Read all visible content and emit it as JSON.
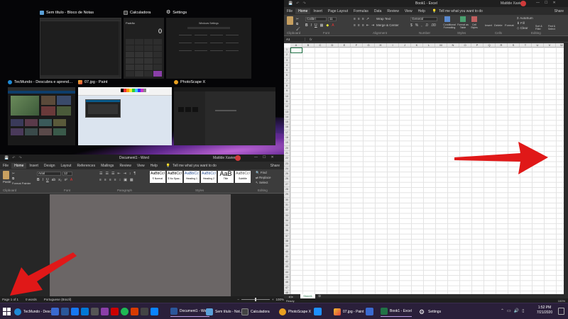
{
  "snap": {
    "thumbnails": [
      {
        "title": "Sem título - Bloco de Notas",
        "icon": "notepad-icon"
      },
      {
        "title": "Calculadora",
        "icon": "calculator-icon"
      },
      {
        "title": "Settings",
        "icon": "gear-icon"
      },
      {
        "title": "TecMundo - Descubra e aprenda tudo sobre...",
        "icon": "edge-icon"
      },
      {
        "title": "07.jpg - Paint",
        "icon": "paint-icon"
      },
      {
        "title": "PhotoScape X",
        "icon": "photoscape-icon"
      }
    ],
    "calc_display": "0",
    "calc_mode": "Padrão",
    "settings_heading": "Windows Settings"
  },
  "word": {
    "title": "Document1 - Word",
    "user": "Matilde Xavier",
    "tabs": [
      "File",
      "Home",
      "Insert",
      "Design",
      "Layout",
      "References",
      "Mailings",
      "Review",
      "View",
      "Help"
    ],
    "active_tab": "Home",
    "tell_me": "Tell me what you want to do",
    "share": "Share",
    "paste": "Paste",
    "format_painter": "Format Painter",
    "font": "Arial",
    "font_size": "12",
    "styles": [
      {
        "preview": "AaBbCcI",
        "name": "¶ Normal"
      },
      {
        "preview": "AaBbCcI",
        "name": "¶ No Spac..."
      },
      {
        "preview": "AaBbCc",
        "name": "Heading 1"
      },
      {
        "preview": "AaBbCcI",
        "name": "Heading 2"
      },
      {
        "preview": "AaB",
        "name": "Title"
      },
      {
        "preview": "AaBbCcI",
        "name": "Subtitle"
      }
    ],
    "editing": [
      "Find",
      "Replace",
      "Select"
    ],
    "groups": [
      "Clipboard",
      "Font",
      "Paragraph",
      "Styles",
      "Editing"
    ],
    "status_page": "Page 1 of 1",
    "status_words": "0 words",
    "status_lang": "Portuguese (Brazil)",
    "zoom": "100%"
  },
  "excel": {
    "title": "Book1 - Excel",
    "user": "Matilde Xavier",
    "tabs": [
      "File",
      "Home",
      "Insert",
      "Page Layout",
      "Formulas",
      "Data",
      "Review",
      "View",
      "Help"
    ],
    "active_tab": "Home",
    "tell_me": "Tell me what you want to do",
    "share": "Share",
    "font": "Calibri",
    "font_size": "11",
    "number_format": "General",
    "wrap_text": "Wrap Text",
    "merge_center": "Merge & Center",
    "cond_format": "Conditional Formatting",
    "format_table": "Format as Table",
    "cell_styles": "Cell Styles",
    "insert": "Insert",
    "delete": "Delete",
    "format": "Format",
    "autosum": "AutoSum",
    "fill": "Fill",
    "clear": "Clear",
    "sort_filter": "Sort & Filter",
    "find_select": "Find & Select",
    "groups": [
      "Clipboard",
      "Font",
      "Alignment",
      "Number",
      "Styles",
      "Cells",
      "Editing"
    ],
    "name_box": "A1",
    "fx": "fx",
    "columns": [
      "A",
      "B",
      "C",
      "D",
      "E",
      "F",
      "G",
      "H",
      "I",
      "J",
      "K",
      "L",
      "M",
      "N",
      "O",
      "P",
      "Q",
      "R",
      "S",
      "T",
      "U",
      "V",
      "W"
    ],
    "sheet_tab": "Sheet1",
    "status_ready": "Ready",
    "zoom": "100%"
  },
  "taskbar": {
    "apps": [
      {
        "label": "TecMundo - Descub...",
        "icon": "edge-icon"
      },
      {
        "label": "Document1 - Word",
        "icon": "word-icon"
      },
      {
        "label": "Sem título - Not...",
        "icon": "notepad-icon"
      },
      {
        "label": "Calculadora",
        "icon": "calculator-icon"
      },
      {
        "label": "PhotoScape X",
        "icon": "photoscape-icon"
      },
      {
        "label": "07.jpg - Paint",
        "icon": "paint-icon"
      },
      {
        "label": "Book1 - Excel",
        "icon": "excel-icon"
      },
      {
        "label": "Settings",
        "icon": "gear-icon"
      }
    ],
    "time": "1:52 PM",
    "date": "7/21/2020"
  },
  "colors": {
    "accent_red": "#e01818",
    "word_blue": "#2b579a",
    "excel_green": "#217346",
    "taskbar": "#2a1f3a"
  }
}
